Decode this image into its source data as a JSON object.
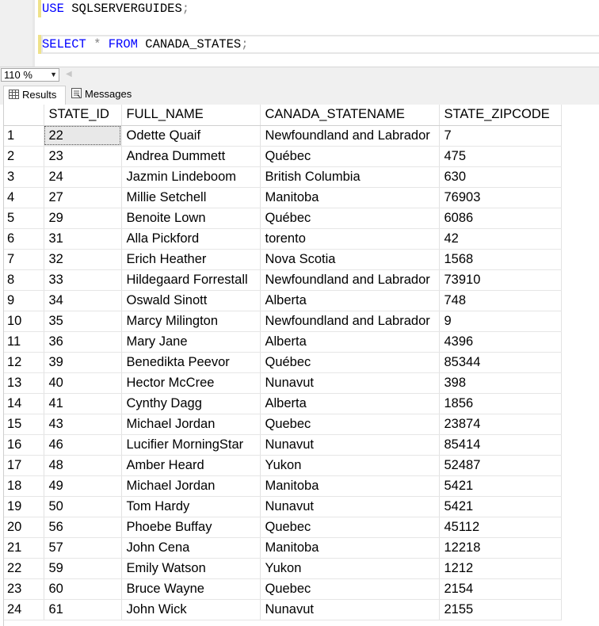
{
  "editor": {
    "line1": {
      "kw": "USE",
      "id": "SQLSERVERGUIDES",
      "end": ";"
    },
    "line2": {
      "kw1": "SELECT",
      "op": "*",
      "kw2": "FROM",
      "id": "CANADA_STATES",
      "end": ";"
    }
  },
  "zoom": {
    "value": "110 %"
  },
  "tabs": {
    "results": "Results",
    "messages": "Messages"
  },
  "grid": {
    "columns": [
      "STATE_ID",
      "FULL_NAME",
      "CANADA_STATENAME",
      "STATE_ZIPCODE"
    ],
    "rows": [
      [
        "1",
        "22",
        "Odette Quaif",
        "Newfoundland and Labrador",
        "7"
      ],
      [
        "2",
        "23",
        "Andrea Dummett",
        "Québec",
        "475"
      ],
      [
        "3",
        "24",
        "Jazmin Lindeboom",
        "British Columbia",
        "630"
      ],
      [
        "4",
        "27",
        "Millie Setchell",
        "Manitoba",
        "76903"
      ],
      [
        "5",
        "29",
        "Benoite Lown",
        "Québec",
        "6086"
      ],
      [
        "6",
        "31",
        "Alla Pickford",
        "torento",
        "42"
      ],
      [
        "7",
        "32",
        "Erich Heather",
        "Nova Scotia",
        "1568"
      ],
      [
        "8",
        "33",
        "Hildegaard Forrestall",
        "Newfoundland and Labrador",
        "73910"
      ],
      [
        "9",
        "34",
        "Oswald Sinott",
        "Alberta",
        "748"
      ],
      [
        "10",
        "35",
        "Marcy Milington",
        "Newfoundland and Labrador",
        "9"
      ],
      [
        "11",
        "36",
        "Mary Jane",
        "Alberta",
        "4396"
      ],
      [
        "12",
        "39",
        "Benedikta Peevor",
        "Québec",
        "85344"
      ],
      [
        "13",
        "40",
        "Hector McCree",
        "Nunavut",
        "398"
      ],
      [
        "14",
        "41",
        "Cynthy Dagg",
        "Alberta",
        "1856"
      ],
      [
        "15",
        "43",
        "Michael Jordan",
        "Quebec",
        "23874"
      ],
      [
        "16",
        "46",
        "Lucifier MorningStar",
        "Nunavut",
        "85414"
      ],
      [
        "17",
        "48",
        "Amber Heard",
        "Yukon",
        "52487"
      ],
      [
        "18",
        "49",
        "Michael Jordan",
        "Manitoba",
        "5421"
      ],
      [
        "19",
        "50",
        "Tom Hardy",
        "Nunavut",
        "5421"
      ],
      [
        "20",
        "56",
        "Phoebe Buffay",
        "Quebec",
        "45112"
      ],
      [
        "21",
        "57",
        "John Cena",
        "Manitoba",
        "12218"
      ],
      [
        "22",
        "59",
        "Emily Watson",
        "Yukon",
        "1212"
      ],
      [
        "23",
        "60",
        "Bruce Wayne",
        "Quebec",
        "2154"
      ],
      [
        "24",
        "61",
        "John Wick",
        "Nunavut",
        "2155"
      ]
    ]
  },
  "colors": {
    "keyword": "#0000ff",
    "operator": "#808080",
    "selected_cell": "#e8e8e8"
  }
}
